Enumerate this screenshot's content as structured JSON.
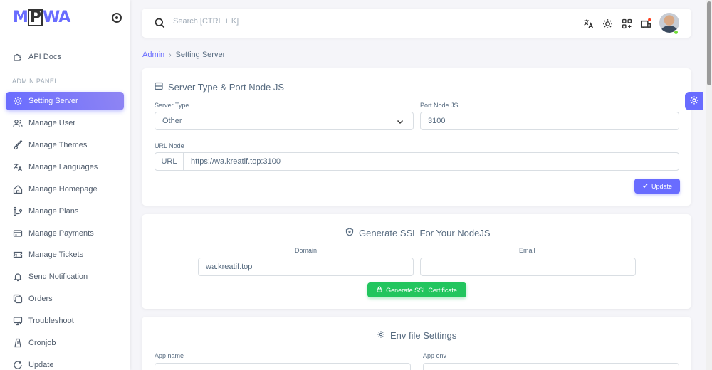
{
  "brand": {
    "logo_left": "M",
    "logo_box": "P",
    "logo_right": "WA"
  },
  "sidebar": {
    "section_label": "ADMIN PANEL",
    "items": [
      {
        "label": "API Docs",
        "icon": "puzzle-icon"
      },
      {
        "label": "Setting Server",
        "icon": "gear-icon",
        "active": true
      },
      {
        "label": "Manage User",
        "icon": "users-icon"
      },
      {
        "label": "Manage Themes",
        "icon": "brush-icon"
      },
      {
        "label": "Manage Languages",
        "icon": "translate-icon"
      },
      {
        "label": "Manage Homepage",
        "icon": "home-icon"
      },
      {
        "label": "Manage Plans",
        "icon": "git-icon"
      },
      {
        "label": "Manage Payments",
        "icon": "credit-card-icon"
      },
      {
        "label": "Manage Tickets",
        "icon": "ticket-icon"
      },
      {
        "label": "Send Notification",
        "icon": "bell-icon"
      },
      {
        "label": "Orders",
        "icon": "copy-icon"
      },
      {
        "label": "Troubleshoot",
        "icon": "monitor-icon"
      },
      {
        "label": "Cronjob",
        "icon": "timer-icon"
      },
      {
        "label": "Update",
        "icon": "refresh-icon"
      }
    ]
  },
  "topbar": {
    "search_placeholder": "Search [CTRL + K]"
  },
  "breadcrumb": {
    "parent": "Admin",
    "current": "Setting Server"
  },
  "server_card": {
    "title": "Server Type & Port Node JS",
    "server_type_label": "Server Type",
    "server_type_value": "Other",
    "port_label": "Port Node JS",
    "port_value": "3100",
    "url_label": "URL Node",
    "url_prefix": "URL",
    "url_value": "https://wa.kreatif.top:3100",
    "update_button": "Update"
  },
  "ssl_card": {
    "title": "Generate SSL For Your NodeJS",
    "domain_label": "Domain",
    "domain_value": "wa.kreatif.top",
    "email_label": "Email",
    "email_value": "",
    "generate_button": "Generate SSL Certificate"
  },
  "env_card": {
    "title": "Env file Settings",
    "app_name_label": "App name",
    "app_env_label": "App env"
  },
  "colors": {
    "primary": "#696cff",
    "success": "#22c55e",
    "background": "#f5f5f9"
  }
}
